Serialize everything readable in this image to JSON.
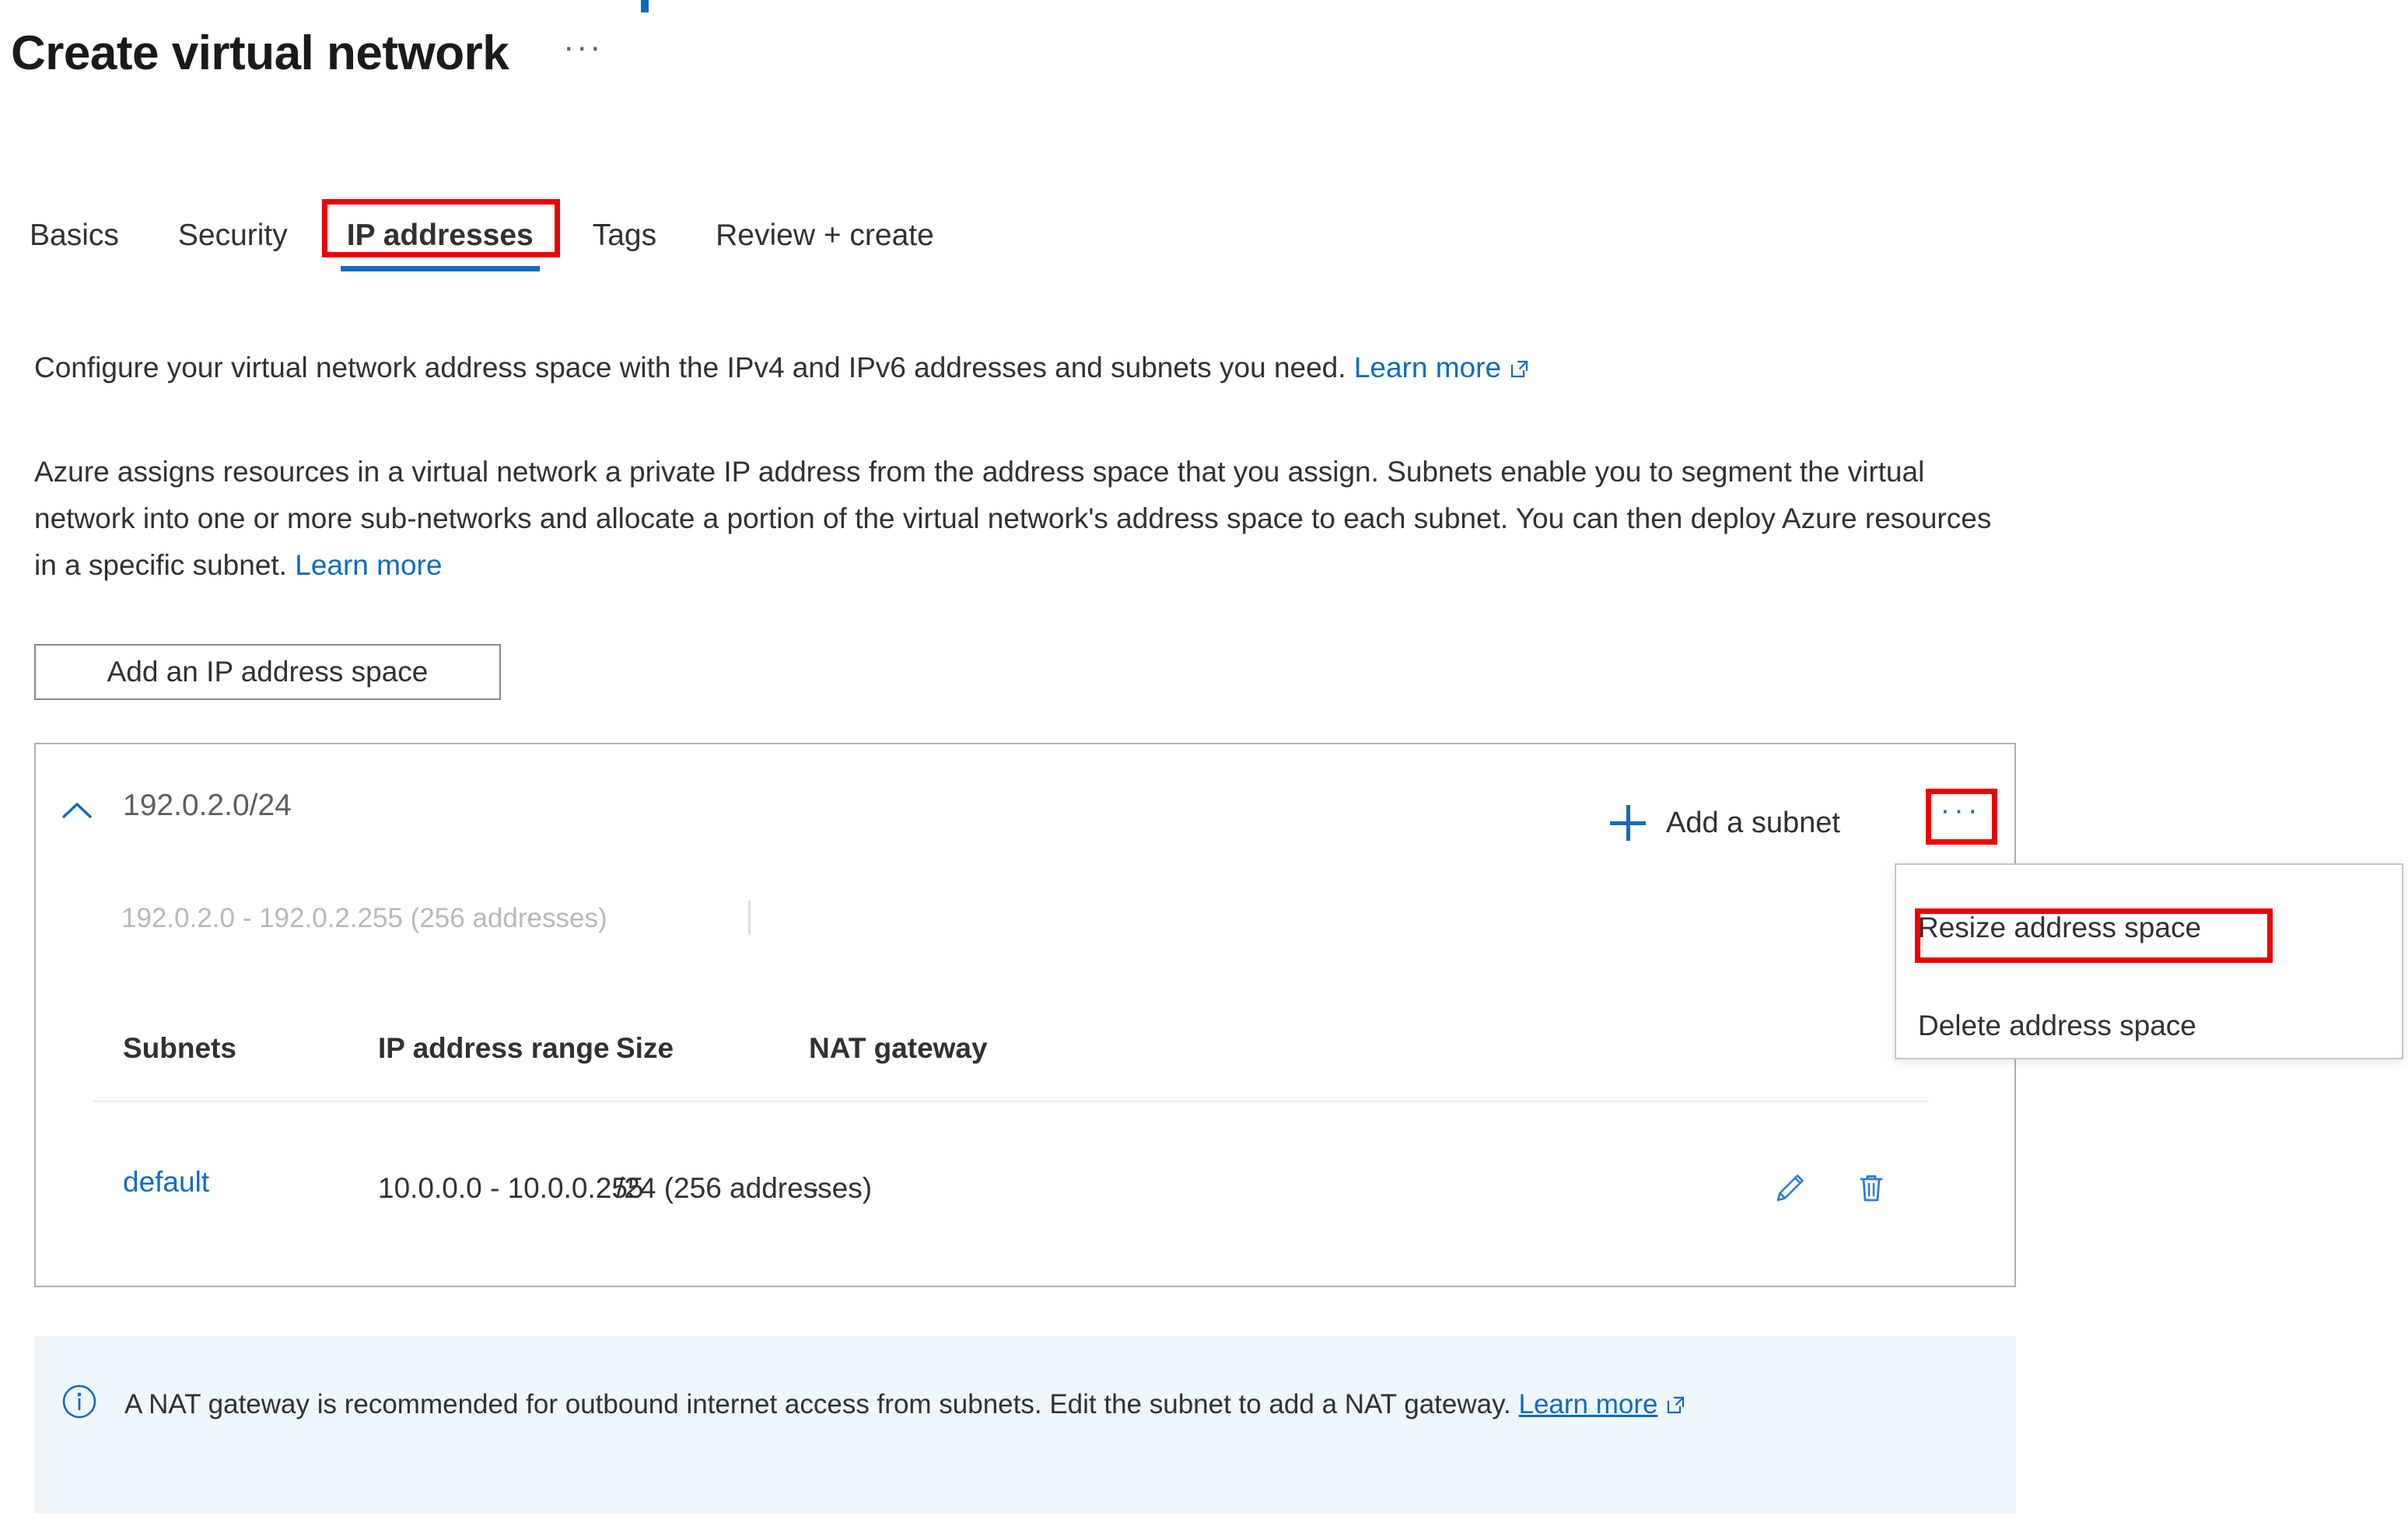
{
  "header": {
    "title": "Create virtual network",
    "more_menu": "···"
  },
  "tabs": [
    {
      "label": "Basics",
      "active": false
    },
    {
      "label": "Security",
      "active": false
    },
    {
      "label": "IP addresses",
      "active": true
    },
    {
      "label": "Tags",
      "active": false
    },
    {
      "label": "Review + create",
      "active": false
    }
  ],
  "description": {
    "line1_text": "Configure your virtual network address space with the IPv4 and IPv6 addresses and subnets you need.",
    "line1_link": "Learn more",
    "body_text": "Azure assigns resources in a virtual network a private IP address from the address space that you assign. Subnets enable you to segment the virtual network into one or more sub-networks and allocate a portion of the virtual network's address space to each subnet. You can then deploy Azure resources in a specific subnet.",
    "body_link": "Learn more"
  },
  "toolbar": {
    "add_address_space_label": "Add an IP address space"
  },
  "address_space": {
    "cidr": "192.0.2.0/24",
    "range": "192.0.2.0 - 192.0.2.255 (256 addresses)",
    "collapse_icon": "chevron-up-icon",
    "add_subnet_label": "Add a subnet",
    "more_button_label": "···"
  },
  "context_menu": {
    "items": [
      {
        "label": "Resize address space",
        "highlighted": false
      },
      {
        "label": "Delete address space",
        "highlighted": true
      }
    ]
  },
  "subnets_table": {
    "columns": [
      "Subnets",
      "IP address range",
      "Size",
      "NAT gateway"
    ],
    "rows": [
      {
        "name": "default",
        "ip_address_range": "10.0.0.0 - 10.0.0.255",
        "size": "/24 (256 addresses)",
        "nat_gateway": "-",
        "edit_icon": "pencil-icon",
        "delete_icon": "trash-icon"
      }
    ]
  },
  "info_banner": {
    "icon": "info-circle-icon",
    "text": "A NAT gateway is recommended for outbound internet access from subnets. Edit the subnet to add a NAT gateway.",
    "link": "Learn more"
  },
  "colors": {
    "accent_blue": "#0f6cbd",
    "annotation_red": "#ee0000",
    "info_banner_bg": "#eff6fc",
    "muted_text": "#605e5c"
  }
}
